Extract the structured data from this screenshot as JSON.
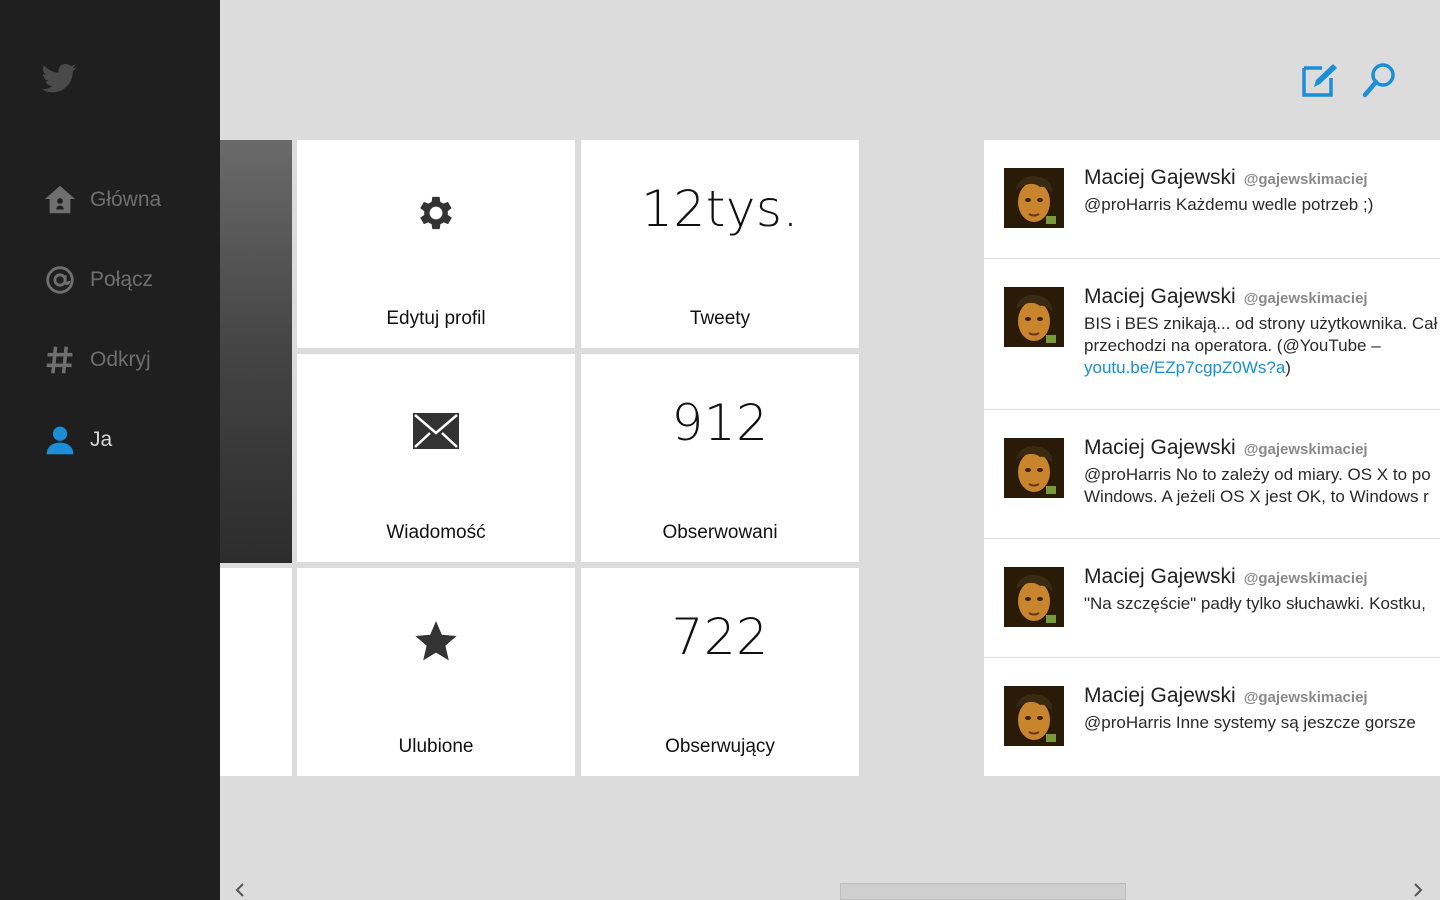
{
  "app": {
    "brand": "twitter-bird-icon",
    "accent": "#1a8fd6"
  },
  "sidebar": {
    "items": [
      {
        "label": "Główna",
        "icon": "home-icon"
      },
      {
        "label": "Połącz",
        "icon": "at-icon"
      },
      {
        "label": "Odkryj",
        "icon": "hashtag-icon"
      },
      {
        "label": "Ja",
        "icon": "user-icon",
        "active": true
      }
    ]
  },
  "toolbar": {
    "compose": "compose-icon",
    "search": "search-icon"
  },
  "profile": {
    "tiles": [
      {
        "label": "Edytuj profil",
        "icon": "gear-icon"
      },
      {
        "label": "Tweety",
        "value": "12tys."
      },
      {
        "label": "Wiadomość",
        "icon": "envelope-icon"
      },
      {
        "label": "Obserwowani",
        "value": "912"
      },
      {
        "label": "Ulubione",
        "icon": "star-icon"
      },
      {
        "label": "Obserwujący",
        "value": "722"
      }
    ]
  },
  "tweets": [
    {
      "name": "Maciej Gajewski",
      "handle": "@gajewskimaciej",
      "lines": [
        "@proHarris Każdemu wedle potrzeb ;)"
      ]
    },
    {
      "name": "Maciej Gajewski",
      "handle": "@gajewskimaciej",
      "lines": [
        "BIS i BES znikają... od strony użytkownika. Cał",
        "przechodzi na operatora. (@YouTube –"
      ],
      "link": "youtu.be/EZp7cgpZ0Ws?a",
      "link_suffix": ")"
    },
    {
      "name": "Maciej Gajewski",
      "handle": "@gajewskimaciej",
      "lines": [
        "@proHarris No to zależy od miary. OS X to po",
        "Windows. A jeżeli OS X jest OK, to Windows r"
      ]
    },
    {
      "name": "Maciej Gajewski",
      "handle": "@gajewskimaciej",
      "lines": [
        "\"Na szczęście\" padły tylko słuchawki. Kostku,"
      ]
    },
    {
      "name": "Maciej Gajewski",
      "handle": "@gajewskimaciej",
      "lines": [
        "@proHarris Inne systemy są jeszcze gorsze"
      ]
    }
  ],
  "scrollbar": {
    "left": "chevron-left-icon",
    "right": "chevron-right-icon"
  }
}
